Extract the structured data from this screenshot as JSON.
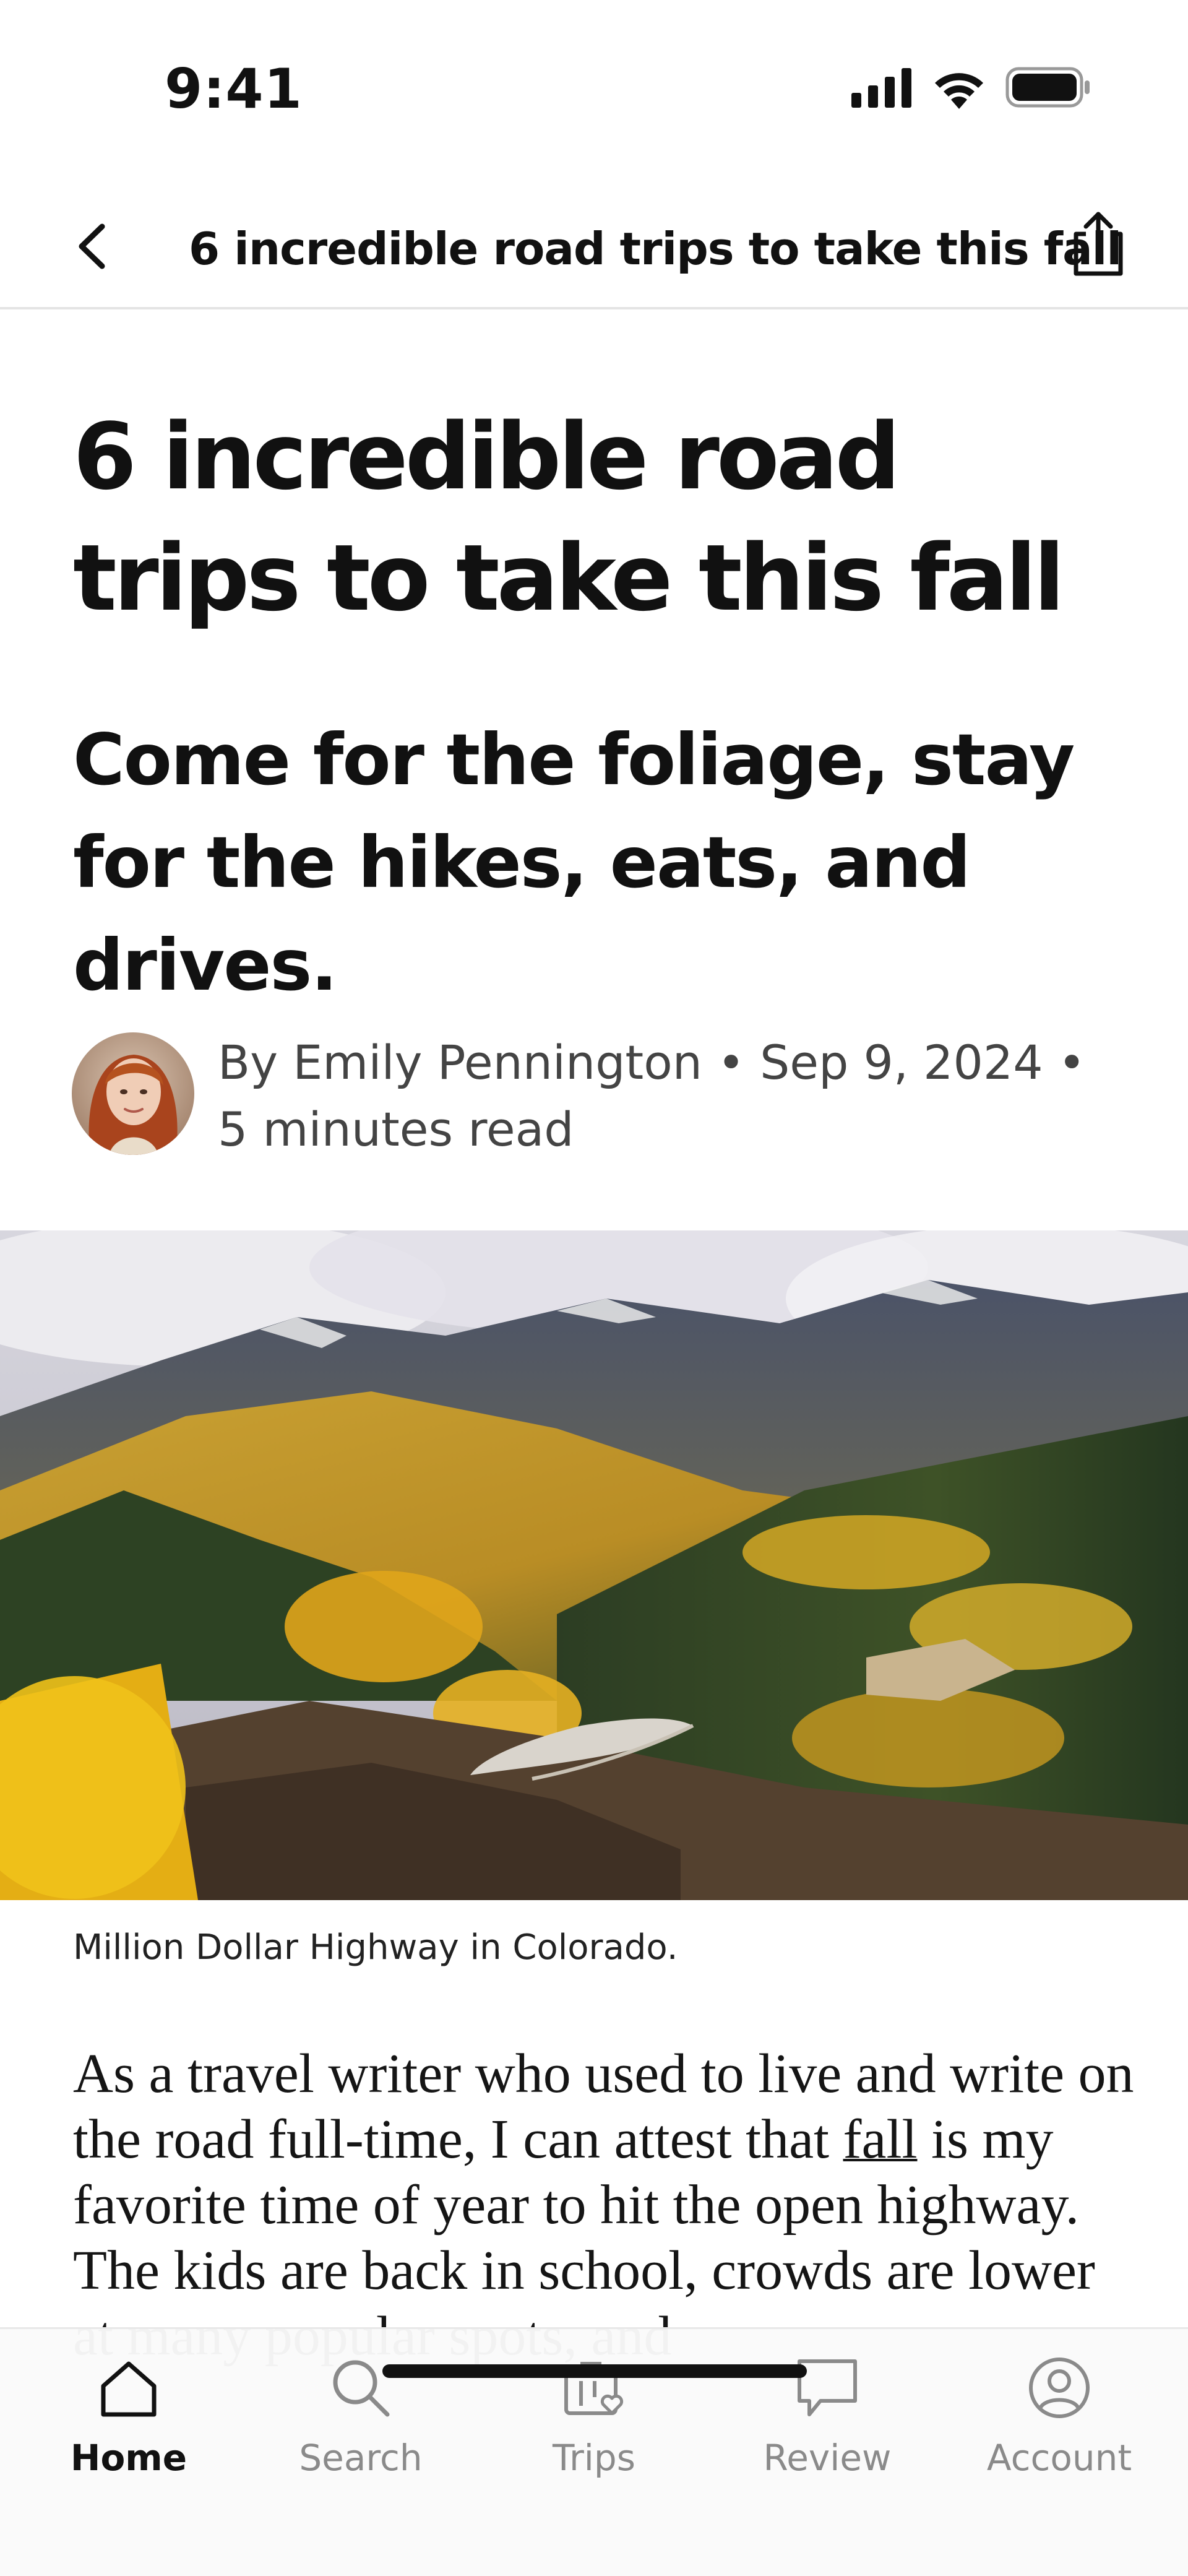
{
  "status_bar": {
    "time": "9:41"
  },
  "nav": {
    "title": "6 incredible road trips to take this fall"
  },
  "article": {
    "title": "6 incredible road trips to take this fall",
    "subtitle": "Come for the foliage, stay for the hikes, eats, and drives.",
    "byline": {
      "author": "By Emily Pennington",
      "date": "Sep 9, 2024",
      "read_time": "5 minutes read",
      "separator": " • "
    },
    "image_caption": "Million Dollar Highway in Colorado.",
    "body": {
      "before_link": "As a travel writer who used to live and write on the road full-time, I can attest that ",
      "link_text": "fall",
      "after_link": " is my favorite time of year to hit the open highway. The kids are back in school, crowds are lower at many popular spots, and"
    }
  },
  "tabs": [
    {
      "label": "Home",
      "icon": "home-icon",
      "active": true
    },
    {
      "label": "Search",
      "icon": "search-icon",
      "active": false
    },
    {
      "label": "Trips",
      "icon": "suitcase-heart-icon",
      "active": false
    },
    {
      "label": "Review",
      "icon": "speech-bubble-icon",
      "active": false
    },
    {
      "label": "Account",
      "icon": "account-icon",
      "active": false
    }
  ],
  "colors": {
    "text_primary": "#111111",
    "text_secondary": "#444444",
    "tab_inactive": "#8a8a8a",
    "divider": "#e4e4e4"
  }
}
